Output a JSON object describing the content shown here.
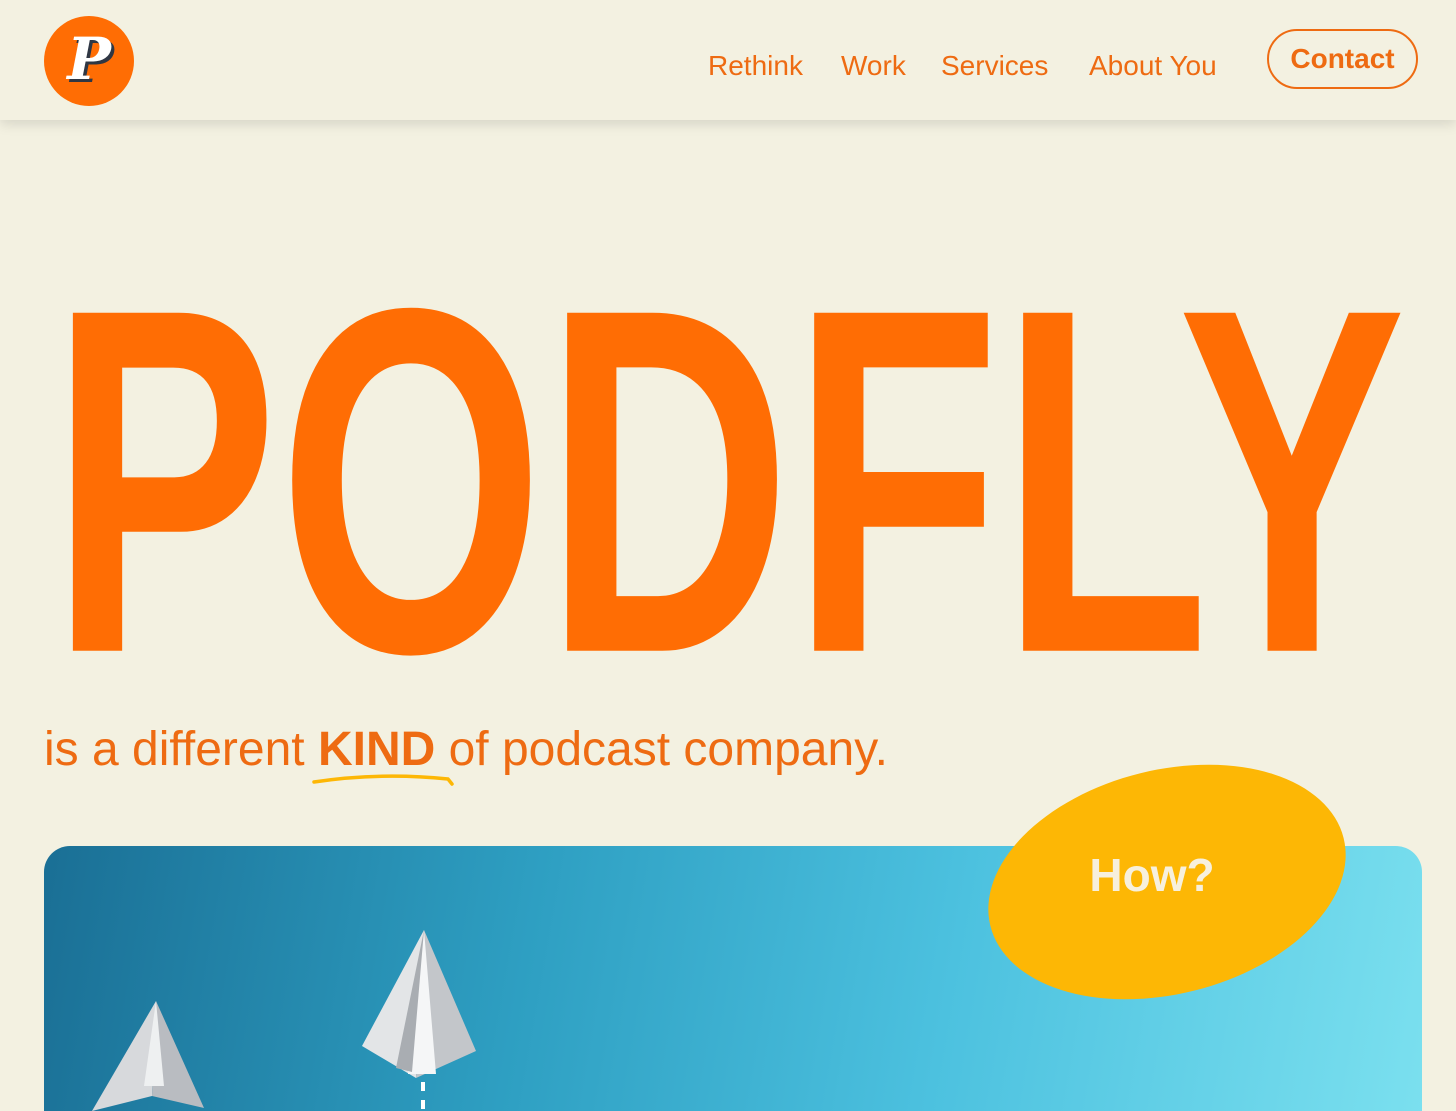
{
  "brand": {
    "logo_letter": "P",
    "accent_color": "#ff6d04",
    "background_color": "#f3f1e1"
  },
  "nav": {
    "items": [
      {
        "label": "Rethink"
      },
      {
        "label": "Work"
      },
      {
        "label": "Services"
      },
      {
        "label": "About You"
      }
    ],
    "contact_label": "Contact"
  },
  "hero": {
    "title": "PODFLY",
    "tagline_before": "is a different ",
    "tagline_emphasis": "KIND",
    "tagline_after": " of podcast company.",
    "how_label": "How?",
    "how_color": "#fdb705",
    "banner_image": "paper-airplanes-on-blue-gradient"
  }
}
